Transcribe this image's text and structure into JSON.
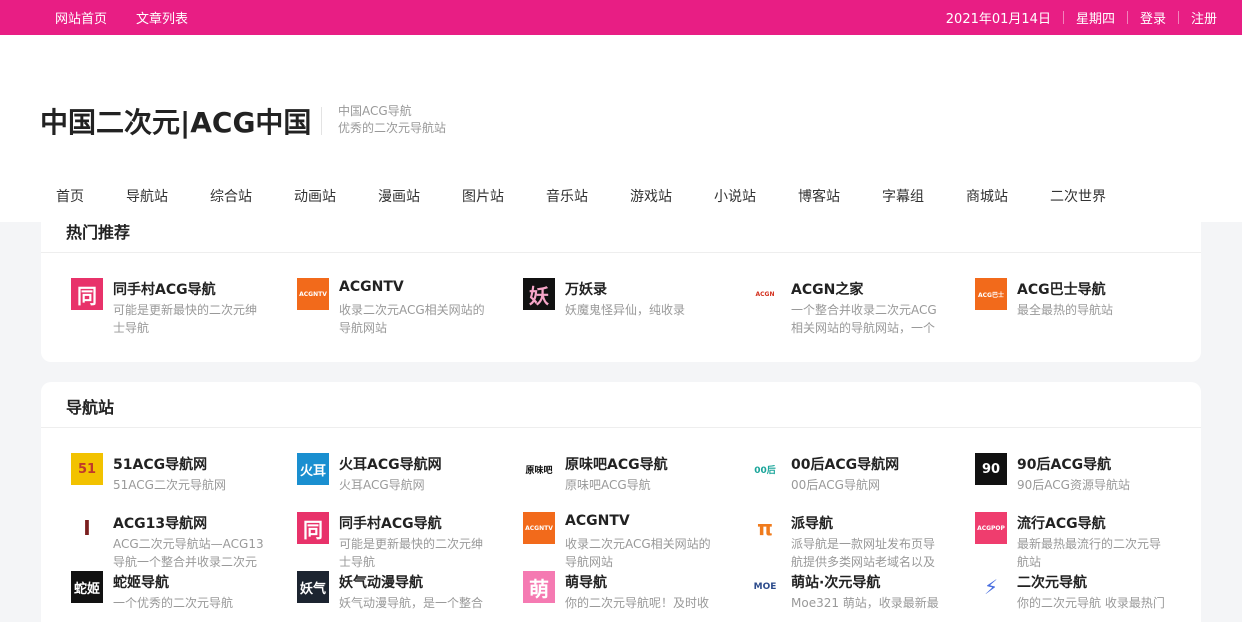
{
  "topbar": {
    "links": [
      "网站首页",
      "文章列表"
    ],
    "date": "2021年01月14日",
    "weekday": "星期四",
    "login": "登录",
    "register": "注册"
  },
  "header": {
    "title": "中国二次元|ACG中国",
    "subtitle_line1": "中国ACG导航",
    "subtitle_line2": "优秀的二次元导航站"
  },
  "menu": [
    "首页",
    "导航站",
    "综合站",
    "动画站",
    "漫画站",
    "图片站",
    "音乐站",
    "游戏站",
    "小说站",
    "博客站",
    "字幕组",
    "商城站",
    "二次世界"
  ],
  "hot": {
    "title": "热门推荐",
    "items": [
      {
        "name": "同手村ACG导航",
        "desc": "可能是更新最快的二次元绅士导航",
        "logo_text": "同",
        "logo_bg": "#e8326a",
        "logo_fg": "#ffffff"
      },
      {
        "name": "ACGNTV",
        "desc": "收录二次元ACG相关网站的导航网站",
        "logo_text": "ACGNTV",
        "logo_bg": "#f26a1b",
        "logo_fg": "#ffffff"
      },
      {
        "name": "万妖录",
        "desc": "妖魔鬼怪异仙，纯收录",
        "logo_text": "妖",
        "logo_bg": "#111111",
        "logo_fg": "#f6a6c8"
      },
      {
        "name": "ACGN之家",
        "desc": "一个整合并收录二次元ACG相关网站的导航网站，一个",
        "logo_text": "ACGN",
        "logo_bg": "#ffffff",
        "logo_fg": "#d4311f"
      },
      {
        "name": "ACG巴士导航",
        "desc": "最全最热的导航站",
        "logo_text": "ACG巴士",
        "logo_bg": "#f26a1b",
        "logo_fg": "#ffffff"
      }
    ]
  },
  "nav": {
    "title": "导航站",
    "items": [
      {
        "name": "51ACG导航网",
        "desc": "51ACG二次元导航网",
        "logo_text": "51",
        "logo_bg": "#f2c200",
        "logo_fg": "#c0392b"
      },
      {
        "name": "火耳ACG导航网",
        "desc": "火耳ACG导航网",
        "logo_text": "火耳",
        "logo_bg": "#1a8fd0",
        "logo_fg": "#ffffff"
      },
      {
        "name": "原味吧ACG导航",
        "desc": "原味吧ACG导航",
        "logo_text": "原味吧",
        "logo_bg": "#ffffff",
        "logo_fg": "#111111"
      },
      {
        "name": "00后ACG导航网",
        "desc": "00后ACG导航网",
        "logo_text": "00后",
        "logo_bg": "#ffffff",
        "logo_fg": "#1aa59a"
      },
      {
        "name": "90后ACG导航",
        "desc": "90后ACG资源导航站",
        "logo_text": "90",
        "logo_bg": "#111111",
        "logo_fg": "#ffffff"
      },
      {
        "name": "ACG13导航网",
        "desc": "ACG二次元导航站—ACG13导航一个整合并收录二次元",
        "logo_text": "I",
        "logo_bg": "#ffffff",
        "logo_fg": "#7a1f1f"
      },
      {
        "name": "同手村ACG导航",
        "desc": "可能是更新最快的二次元绅士导航",
        "logo_text": "同",
        "logo_bg": "#e8326a",
        "logo_fg": "#ffffff"
      },
      {
        "name": "ACGNTV",
        "desc": "收录二次元ACG相关网站的导航网站",
        "logo_text": "ACGNTV",
        "logo_bg": "#f26a1b",
        "logo_fg": "#ffffff"
      },
      {
        "name": "派导航",
        "desc": "派导航是一款网址发布页导航提供多类网站老域名以及",
        "logo_text": "π",
        "logo_bg": "#ffffff",
        "logo_fg": "#f07b1d"
      },
      {
        "name": "流行ACG导航",
        "desc": "最新最热最流行的二次元导航站",
        "logo_text": "ACGPOP",
        "logo_bg": "#ef3d6e",
        "logo_fg": "#ffffff"
      },
      {
        "name": "蛇姬导航",
        "desc": "一个优秀的二次元导航",
        "logo_text": "蛇姬",
        "logo_bg": "#111111",
        "logo_fg": "#ffffff"
      },
      {
        "name": "妖气动漫导航",
        "desc": "妖气动漫导航，是一个整合",
        "logo_text": "妖气",
        "logo_bg": "#1c2430",
        "logo_fg": "#ffffff"
      },
      {
        "name": "萌导航",
        "desc": "你的二次元导航呢！及时收",
        "logo_text": "萌",
        "logo_bg": "#f57ab2",
        "logo_fg": "#ffffff"
      },
      {
        "name": "萌站·次元导航",
        "desc": "Moe321 萌站，收录最新最",
        "logo_text": "MOE",
        "logo_bg": "#ffffff",
        "logo_fg": "#2d4c8c"
      },
      {
        "name": "二次元导航",
        "desc": "你的二次元导航 收录最热门",
        "logo_text": "⚡",
        "logo_bg": "#ffffff",
        "logo_fg": "#4a6fe0"
      }
    ]
  }
}
